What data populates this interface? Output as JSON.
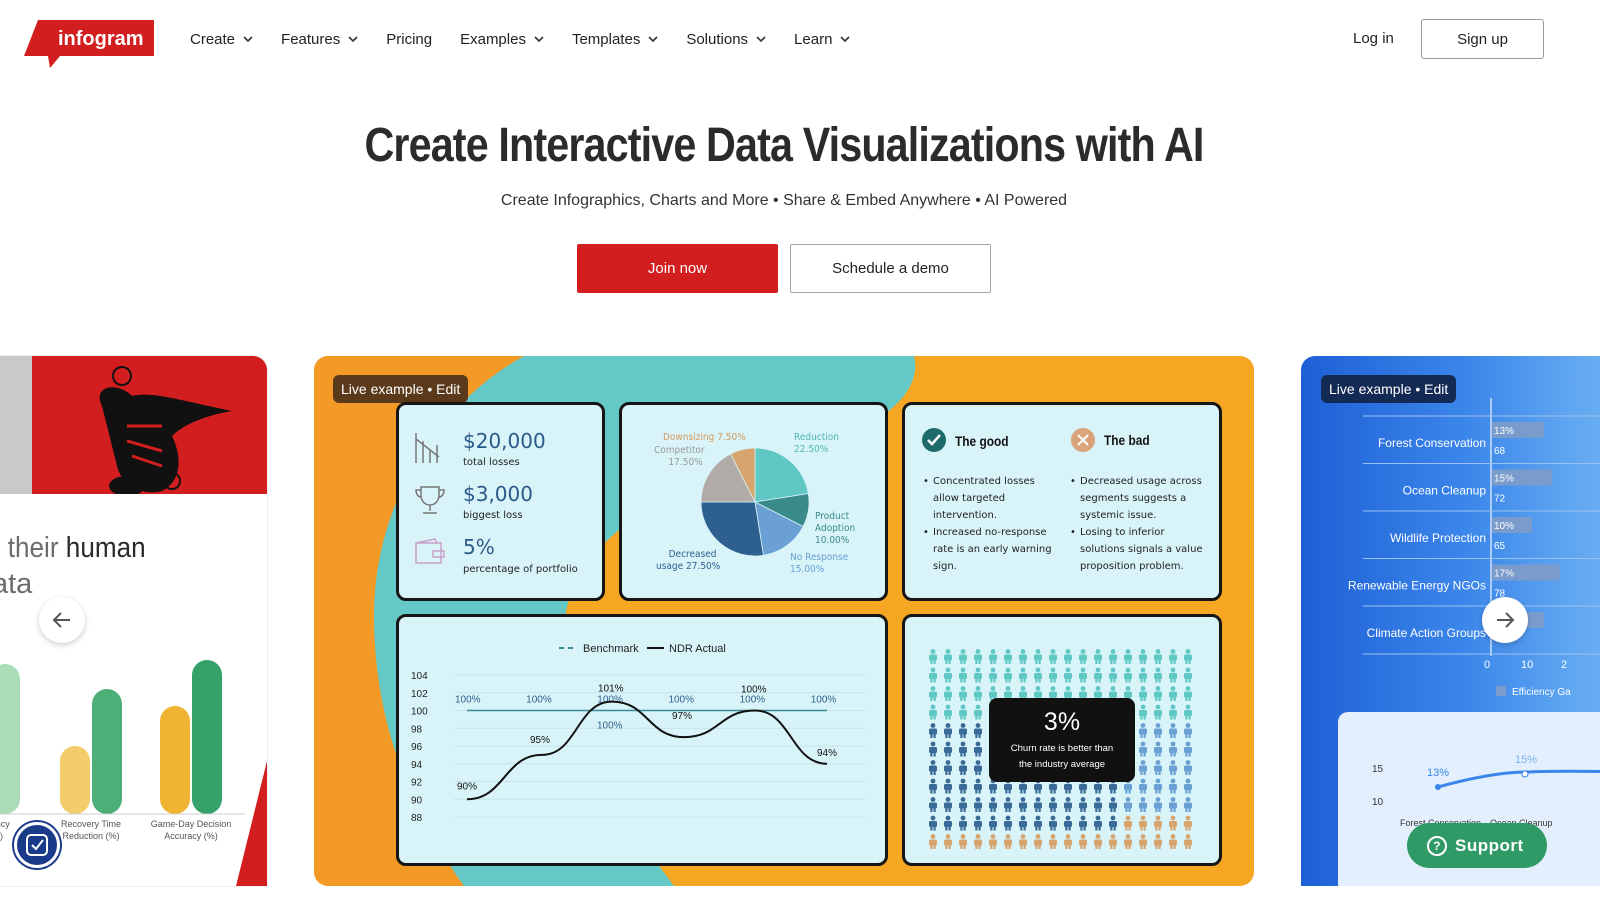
{
  "brand": {
    "logo_text": "infogram",
    "red": "#d21e1e"
  },
  "nav": {
    "items": [
      {
        "label": "Create",
        "dropdown": true
      },
      {
        "label": "Features",
        "dropdown": true
      },
      {
        "label": "Pricing",
        "dropdown": false
      },
      {
        "label": "Examples",
        "dropdown": true
      },
      {
        "label": "Templates",
        "dropdown": true
      },
      {
        "label": "Solutions",
        "dropdown": true
      },
      {
        "label": "Learn",
        "dropdown": true
      }
    ],
    "login": "Log in",
    "signup": "Sign up"
  },
  "hero": {
    "title": "Create Interactive Data Visualizations with AI",
    "subtitle": "Create Infographics, Charts and More • Share & Embed Anywhere • AI Powered",
    "join": "Join now",
    "demo": "Schedule a demo"
  },
  "carousel": {
    "left_card": {
      "line1_grey": "o their ",
      "line1_dark": "human",
      "line2": "ata",
      "bar_labels": [
        "iciency\n(%)",
        "Recovery Time\nReduction (%)",
        "Game-Day Decision\nAccuracy (%)"
      ]
    },
    "main_card": {
      "pill": "Live example • Edit",
      "stats": [
        {
          "value": "$20,000",
          "label": "total losses",
          "icon": "chart-down-icon"
        },
        {
          "value": "$3,000",
          "label": "biggest loss",
          "icon": "trophy-icon"
        },
        {
          "value": "5%",
          "label": "percentage of portfolio",
          "icon": "wallet-icon"
        }
      ],
      "pie": {
        "slices": [
          {
            "name": "Reduction",
            "value": 22.5,
            "display": "22.50%",
            "color": "#5fc7c4"
          },
          {
            "name": "Product Adoption",
            "value": 10.0,
            "display": "10.00%",
            "color": "#3a8a8a"
          },
          {
            "name": "No Response",
            "value": 15.0,
            "display": "15.00%",
            "color": "#6aa0d4"
          },
          {
            "name": "Decreased usage",
            "value": 27.5,
            "display": "27.50%",
            "color": "#2d5f8f"
          },
          {
            "name": "Competitor",
            "value": 17.5,
            "display": "17.50%",
            "color": "#b0aba7"
          },
          {
            "name": "Downsizing",
            "value": 7.5,
            "display": "7.50%",
            "color": "#d6a56e"
          }
        ],
        "labels": {
          "downsizing": "Downsizing 7.50%",
          "competitor": [
            "Competitor",
            "17.50%"
          ],
          "reduction": [
            "Reduction",
            "22.50%"
          ],
          "product": [
            "Product",
            "Adoption",
            "10.00%"
          ],
          "decreased": [
            "Decreased",
            "usage 27.50%"
          ],
          "noresp": [
            "No Response",
            "15.00%"
          ]
        }
      },
      "good": {
        "title": "The good",
        "items": [
          "Concentrated losses allow targeted intervention.",
          "Increased no-response rate is an early warning sign."
        ]
      },
      "bad": {
        "title": "The bad",
        "items": [
          "Decreased usage across segments suggests a systemic issue.",
          "Losing to inferior solutions signals a value proposition problem."
        ]
      },
      "ndr_chart": {
        "type": "line",
        "legend": [
          "Benchmark",
          "NDR Actual"
        ],
        "y_ticks": [
          "104",
          "102",
          "100",
          "98",
          "96",
          "94",
          "92",
          "90",
          "88"
        ],
        "ylim": [
          88,
          104
        ],
        "benchmark": [
          100,
          100,
          100,
          100,
          100,
          100,
          100,
          100,
          100
        ],
        "benchmark_labels": [
          "100%",
          "100%",
          "100%",
          "100%",
          "100%",
          "100%",
          "100%",
          "100%"
        ],
        "actual": [
          90,
          95,
          101,
          97,
          100,
          94
        ],
        "actual_labels": [
          "90%",
          "95%",
          "101%",
          "97%",
          "100%",
          "94%"
        ]
      },
      "churn": {
        "value": "3%",
        "text": [
          "Churn rate is better than",
          "the industry average"
        ]
      }
    },
    "right_card": {
      "pill": "Live example • Edit",
      "bars": [
        {
          "label": "Forest Conservation",
          "pct": "13%",
          "num": "68"
        },
        {
          "label": "Ocean Cleanup",
          "pct": "15%",
          "num": "72"
        },
        {
          "label": "Wildlife Protection",
          "pct": "10%",
          "num": "65"
        },
        {
          "label": "Renewable Energy NGOs",
          "pct": "17%",
          "num": "78"
        },
        {
          "label": "Climate Action Groups",
          "pct": "",
          "num": ""
        }
      ],
      "axis": [
        "0",
        "10",
        "2"
      ],
      "legend": "Efficiency Ga",
      "mini": {
        "y": [
          "15",
          "10"
        ],
        "labels": [
          "13%",
          "15%"
        ],
        "x": [
          "Forest Conservation",
          "Ocean Cleanup"
        ]
      }
    }
  },
  "support": {
    "label": "Support"
  }
}
